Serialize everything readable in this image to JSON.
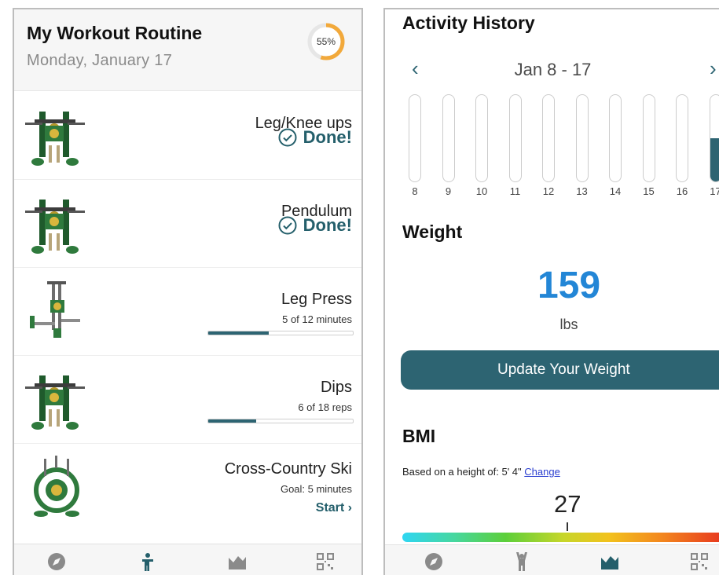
{
  "workout": {
    "title": "My Workout Routine",
    "date": "Monday,  January  17",
    "progress_label": "55%",
    "progress_fraction": 0.55,
    "exercises": [
      {
        "name": "Leg/Knee ups",
        "status": "Done!"
      },
      {
        "name": "Pendulum",
        "status": "Done!"
      },
      {
        "name": "Leg Press",
        "progress_text": "5 of 12 minutes",
        "progress_fraction": 0.4167
      },
      {
        "name": "Dips",
        "progress_text": "6 of 18 reps",
        "progress_fraction": 0.3333
      },
      {
        "name": "Cross-Country Ski",
        "goal_text": "Goal: 5 minutes",
        "action": "Start ›"
      }
    ],
    "nav_icons": [
      "compass-icon",
      "person-icon",
      "chart-icon",
      "qr-code-icon"
    ]
  },
  "activity": {
    "title": "Activity History",
    "week_label": "Jan 8 -  17",
    "prev_symbol": "‹",
    "next_symbol": "›",
    "days": [
      {
        "label": "8",
        "level": 0
      },
      {
        "label": "9",
        "level": 0
      },
      {
        "label": "10",
        "level": 0
      },
      {
        "label": "11",
        "level": 0
      },
      {
        "label": "12",
        "level": 0
      },
      {
        "label": "13",
        "level": 0
      },
      {
        "label": "14",
        "level": 0
      },
      {
        "label": "15",
        "level": 0
      },
      {
        "label": "16",
        "level": 0
      },
      {
        "label": "17",
        "level": 0.5
      }
    ],
    "weight_heading": "Weight",
    "weight_value": "159",
    "weight_unit": "lbs",
    "update_button": "Update Your Weight",
    "bmi_heading": "BMI",
    "bmi_note": "Based on a height of: 5' 4\"",
    "bmi_change": "Change",
    "bmi_value": "27",
    "nav_icons": [
      "compass-icon",
      "person-raised-icon",
      "chart-icon",
      "qr-code-icon"
    ]
  },
  "colors": {
    "accent": "#2d6472",
    "done_text": "#245f6b",
    "weight_blue": "#2386d6",
    "progress_ring": "#f2a93b"
  }
}
